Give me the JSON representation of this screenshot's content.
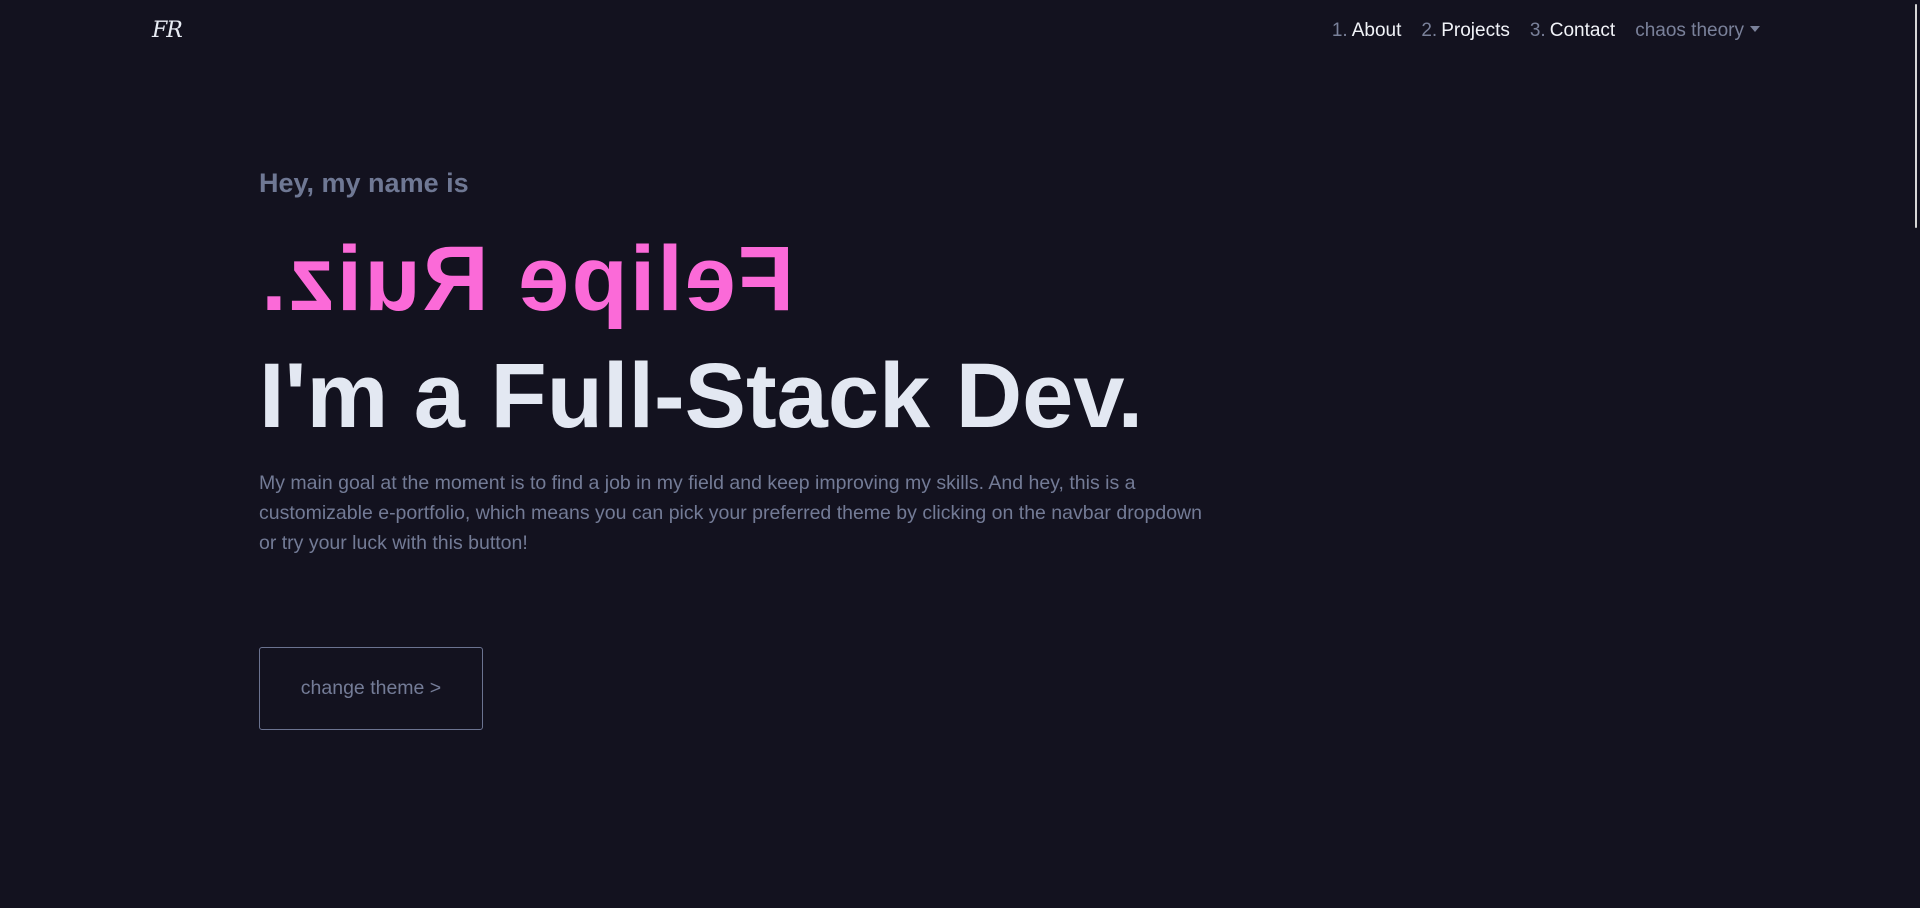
{
  "navbar": {
    "logo": "FR",
    "links": [
      {
        "num": "1.",
        "label": "About"
      },
      {
        "num": "2.",
        "label": "Projects"
      },
      {
        "num": "3.",
        "label": "Contact"
      }
    ],
    "theme_dropdown": {
      "selected": "chaos theory",
      "icon": "caret-down-icon"
    }
  },
  "hero": {
    "greeting": "Hey, my name is",
    "name": "Felipe Ruiz.",
    "headline": "I'm a Full-Stack Dev.",
    "description": "My main goal at the moment is to find a job in my field and keep improving my skills. And hey, this is a customizable e-portfolio, which means you can pick your preferred theme by clicking on the navbar dropdown or try your luck with this button!",
    "button_label": "change theme >"
  },
  "colors": {
    "background": "#13121f",
    "accent": "#fb6ad8",
    "headline": "#e3e8f2",
    "muted": "#737b96",
    "nav_text": "#f1f3f8"
  }
}
